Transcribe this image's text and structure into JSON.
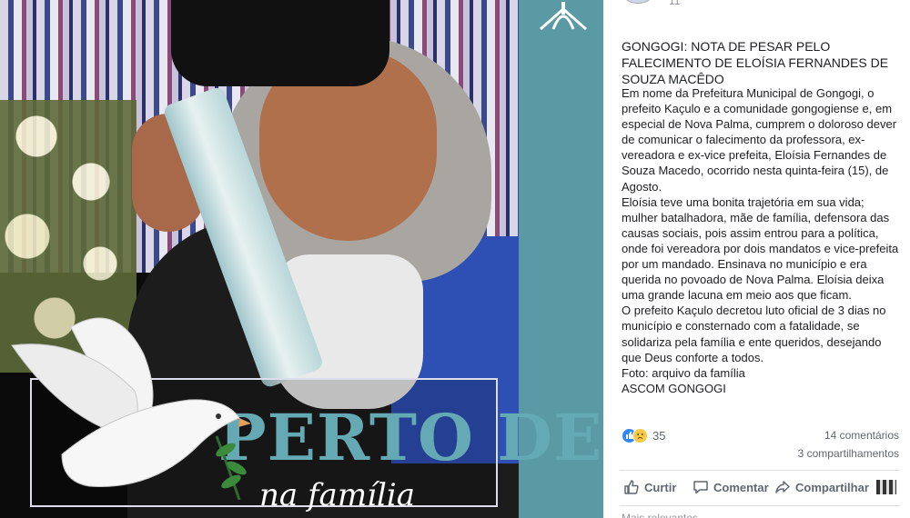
{
  "image": {
    "banner_main": "PERTO DEUS",
    "banner_sub": "na família"
  },
  "post": {
    "meta": "11",
    "title": "GONGOGI: NOTA DE PESAR PELO\nFALECIMENTO DE ELOÍSIA FERNANDES DE\nSOUZA MACÊDO",
    "body": "Em nome da Prefeitura Municipal de Gongogi, o\nprefeito Kaçulo e a comunidade gongogiense e, em\nespecial de Nova Palma, cumprem o doloroso dever\nde comunicar o falecimento da professora, ex-\nvereadora e ex-vice prefeita, Eloísia Fernandes de\nSouza Macedo, ocorrido nesta quinta-feira (15), de\nAgosto.\nEloísia teve uma bonita trajetória em sua vida;\nmulher batalhadora, mãe de família, defensora das\ncausas sociais, pois assim entrou para a política,\nonde foi vereadora por dois mandatos e vice-prefeita\npor um mandado. Ensinava no município e era\nquerida no povoado de Nova Palma. Eloísia deixa\numa grande lacuna em meio aos que ficam.\nO prefeito Kaçulo decretou luto oficial de 3 dias no\nmunicípio e consternado com a fatalidade, se\nsolidariza pela família e ente queridos, desejando\nque Deus conforte a todos.\nFoto: arquivo da família\nASCOM GONGOGI"
  },
  "stats": {
    "reactions_count": "35",
    "comments": "14 comentários",
    "shares": "3 compartilhamentos"
  },
  "actions": {
    "like_label": "Curtir",
    "comment_label": "Comentar",
    "share_label": "Compartilhar"
  },
  "footer": {
    "cutoff": "Mais relevantes"
  },
  "icons": [
    "like-icon",
    "sad-icon",
    "thumbs-up-icon",
    "comment-bubble-icon",
    "share-arrow-icon",
    "dove-icon",
    "church-logo-icon"
  ],
  "colors": {
    "like_blue": "#2d88ff",
    "sad_yellow": "#f7c844",
    "teal_accent": "#64a9b3",
    "muted_text": "#606770"
  }
}
